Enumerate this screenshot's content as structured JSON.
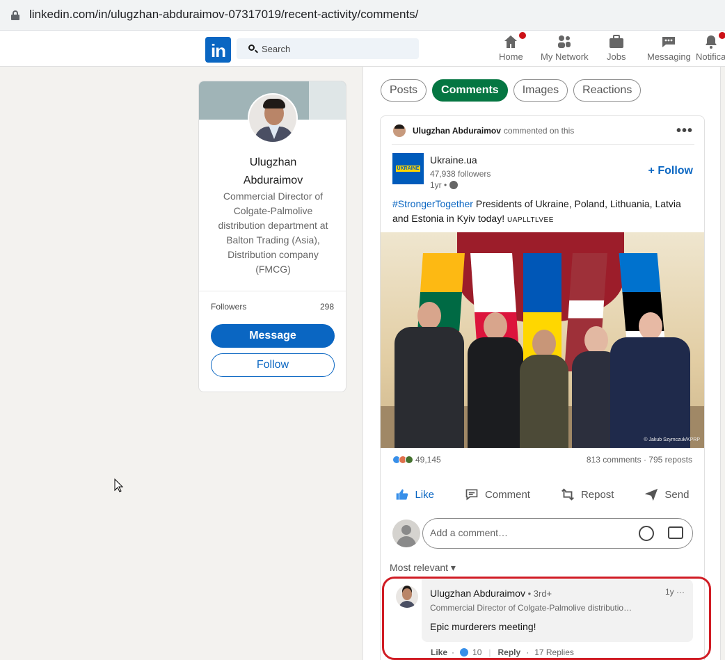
{
  "browser": {
    "url": "linkedin.com/in/ulugzhan-abduraimov-07317019/recent-activity/comments/"
  },
  "nav": {
    "logo": "in",
    "search_placeholder": "Search",
    "items": [
      {
        "label": "Home",
        "icon": "home-icon"
      },
      {
        "label": "My Network",
        "icon": "network-icon"
      },
      {
        "label": "Jobs",
        "icon": "briefcase-icon"
      },
      {
        "label": "Messaging",
        "icon": "messaging-icon"
      },
      {
        "label": "Notifica",
        "icon": "bell-icon"
      }
    ]
  },
  "profile": {
    "name_line1": "Ulugzhan",
    "name_line2": "Abduraimov",
    "title": "Commercial Director of Colgate-Palmolive distribution department at Balton Trading (Asia), Distribution company (FMCG)",
    "followers_label": "Followers",
    "followers_count": "298",
    "message_label": "Message",
    "follow_label": "Follow"
  },
  "tabs": [
    {
      "label": "Posts",
      "active": false
    },
    {
      "label": "Comments",
      "active": true
    },
    {
      "label": "Images",
      "active": false
    },
    {
      "label": "Reactions",
      "active": false
    }
  ],
  "post": {
    "context_name": "Ulugzhan Abduraimov",
    "context_suffix": "commented on this",
    "org_name": "Ukraine.ua",
    "org_logo_text": "UKRAINE",
    "org_followers": "47,938 followers",
    "org_time": "1yr •",
    "follow_label": "+ Follow",
    "text_tag": "#StrongerTogether",
    "text_body": " Presidents of Ukraine, Poland, Lithuania, Latvia and Estonia in Kyiv today! ",
    "text_small": "UAPLLTLVEE",
    "photo_credit": "© Jakub Szymczuk/KPRP",
    "reaction_count": "49,145",
    "comments_reposts": "813 comments · 795 reposts",
    "actions": [
      "Like",
      "Comment",
      "Repost",
      "Send"
    ],
    "comment_placeholder": "Add a comment…",
    "sort_label": "Most relevant ▾"
  },
  "comment": {
    "author": "Ulugzhan Abduraimov",
    "degree": " • 3rd+",
    "time": "1y ···",
    "headline": "Commercial Director of Colgate-Palmolive distributio…",
    "text": "Epic murderers meeting!",
    "like_label": "Like",
    "like_count": "10",
    "reply_label": "Reply",
    "replies": "17 Replies"
  },
  "colors": {
    "linkedin_blue": "#0a66c2",
    "active_tab": "#057642",
    "highlight": "#d01c24"
  }
}
